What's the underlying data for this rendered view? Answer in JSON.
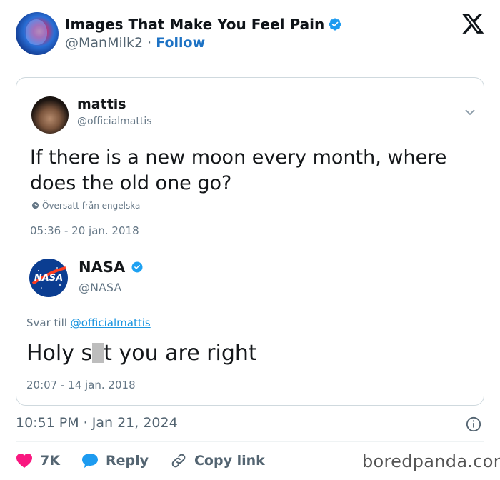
{
  "header": {
    "account_name": "Images That Make You Feel Pain",
    "handle": "@ManMilk2",
    "separator": "·",
    "follow_label": "Follow"
  },
  "embedded_tweet": {
    "author_name": "mattis",
    "author_handle": "@officialmattis",
    "text_line1": "If there is a new moon every month, where",
    "text_line2": "does the old one go?",
    "translated_label": "Översatt från engelska",
    "timestamp": "05:36 - 20 jan. 2018"
  },
  "embedded_reply": {
    "author_name": "NASA",
    "author_handle": "@NASA",
    "logo_text": "NASA",
    "reply_to_prefix": "Svar till",
    "reply_to_handle": "@officialmattis",
    "text_before": "Holy s",
    "text_after": "t you are right",
    "timestamp": "20:07 - 14 jan. 2018"
  },
  "post": {
    "timestamp": "10:51 PM · Jan 21, 2024"
  },
  "actions": {
    "likes": "7K",
    "reply_label": "Reply",
    "copy_label": "Copy link"
  },
  "watermark": "boredpanda.com",
  "icons": [
    "verified-badge-icon",
    "x-logo-icon",
    "chevron-down-icon",
    "globe-icon",
    "info-icon",
    "heart-icon",
    "reply-bubble-icon",
    "link-icon"
  ],
  "colors": {
    "follow_blue": "#1d72c4",
    "verified_blue": "#1d9bf0",
    "like_red": "#f91880",
    "reply_blue": "#1d9bf0",
    "link_blue": "#1b95e0"
  }
}
